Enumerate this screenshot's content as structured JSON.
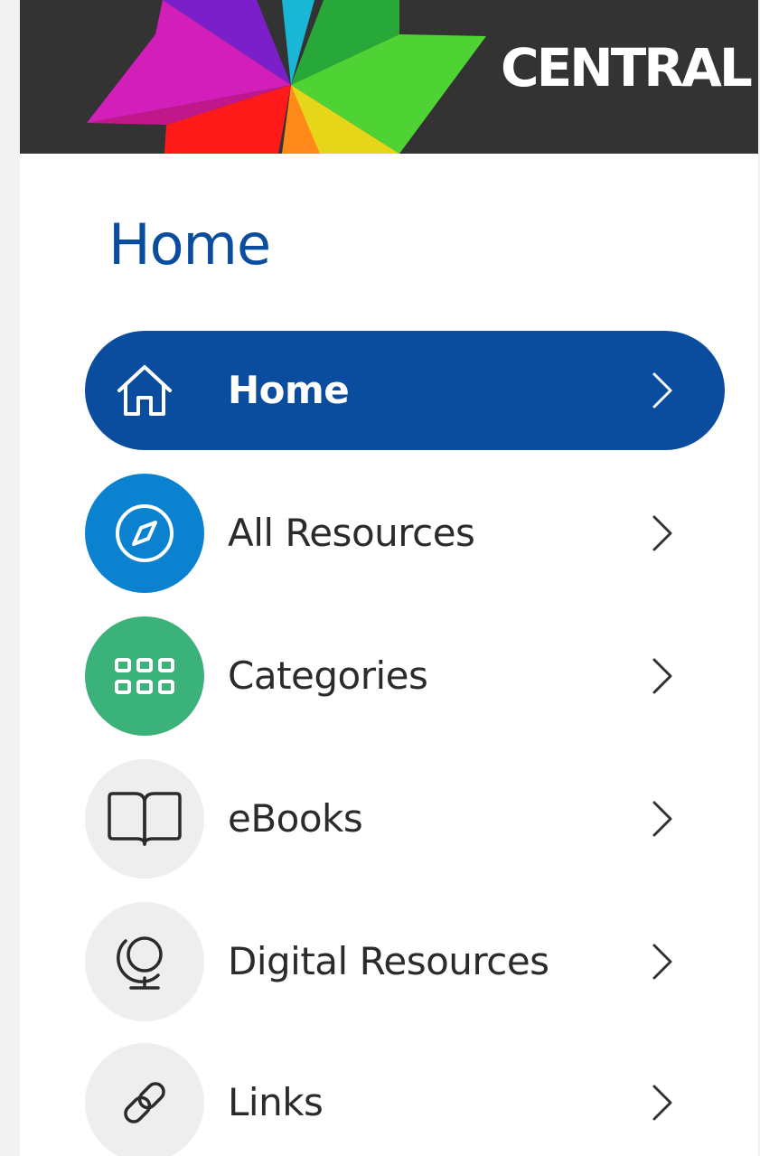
{
  "header": {
    "brand": "CENTRAL"
  },
  "page_title": "Home",
  "colors": {
    "primary": "#0a4d9e",
    "resources": "#0a82cf",
    "categories": "#3bb27a",
    "neutral_circle": "#eeeeee",
    "header_bg": "#333333"
  },
  "nav": {
    "items": [
      {
        "label": "Home",
        "icon": "home-icon",
        "active": true
      },
      {
        "label": "All Resources",
        "icon": "compass-icon",
        "active": false
      },
      {
        "label": "Categories",
        "icon": "grid-icon",
        "active": false
      },
      {
        "label": "eBooks",
        "icon": "book-icon",
        "active": false
      },
      {
        "label": "Digital Resources",
        "icon": "globe-icon",
        "active": false
      },
      {
        "label": "Links",
        "icon": "link-icon",
        "active": false
      }
    ]
  }
}
